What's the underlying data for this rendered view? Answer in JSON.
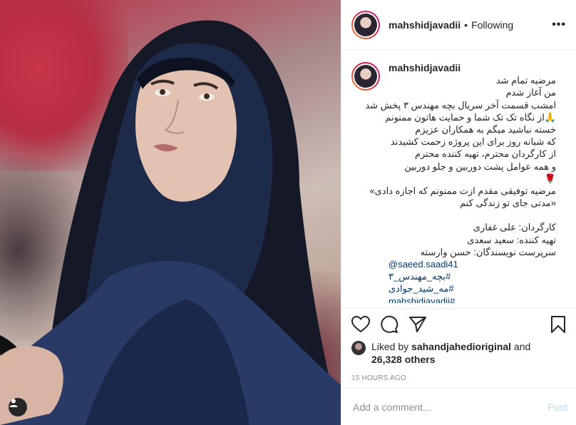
{
  "post": {
    "username": "mahshidjavadii",
    "follow_separator": "•",
    "follow_status": "Following",
    "more_icon": "more-horizontal-icon"
  },
  "caption": {
    "username": "mahshidjavadii",
    "lines": [
      {
        "text": "مرضیه تمام شد",
        "kind": "rtl"
      },
      {
        "text": "من آغاز شدم",
        "kind": "rtl"
      },
      {
        "text": "امشب قسمت آخر سریال بچه مهندس ۳ پخش شد",
        "kind": "rtl"
      },
      {
        "text": "🙏از نگاه تک تک شما و حمایت هاتون ممنونم",
        "kind": "rtl"
      },
      {
        "text": "خسته نباشید میگم به همکاران عزیزم",
        "kind": "rtl"
      },
      {
        "text": "که شبانه روز برای این پروژه زحمت کشیدند",
        "kind": "rtl"
      },
      {
        "text": "از کارگردان محترم، تهیه کننده محترم",
        "kind": "rtl"
      },
      {
        "text": "و همه عوامل پشت دوربین و جلو دوربین",
        "kind": "rtl"
      },
      {
        "text": "🌹",
        "kind": "rtl"
      },
      {
        "text": "مرضیه توفیقی مقدم ازت ممنونم که اجازه دادی»",
        "kind": "rtl"
      },
      {
        "text": "«مدتی جای تو زندگی کنم",
        "kind": "rtl"
      },
      {
        "text": "",
        "kind": "blank"
      },
      {
        "text": "کارگردان: علی غفاری",
        "kind": "rtl"
      },
      {
        "text": "تهیه کننده: سعید سعدی",
        "kind": "rtl"
      },
      {
        "text": "سرپرست نویسندگان: حسن وارسته",
        "kind": "rtl"
      },
      {
        "text": "@saeed.saadi41",
        "kind": "link"
      },
      {
        "text": "#بچه_مهندس_۳",
        "kind": "tag"
      },
      {
        "text": "#مه_شید_جوادی",
        "kind": "tag"
      },
      {
        "text": "#mahshidjavadii",
        "kind": "tag"
      }
    ]
  },
  "actions": {
    "like_icon": "heart-icon",
    "comment_icon": "comment-icon",
    "share_icon": "share-icon",
    "save_icon": "bookmark-icon"
  },
  "likes": {
    "prefix": "Liked by",
    "liker": "sahandjahedioriginal",
    "conjunction": "and",
    "others": "26,328 others"
  },
  "timestamp": "15 HOURS AGO",
  "comment": {
    "placeholder": "Add a comment...",
    "post_label": "Post"
  },
  "colors": {
    "link": "#00376b",
    "post_disabled": "#b2dffc",
    "muted": "#8e8e8e"
  }
}
